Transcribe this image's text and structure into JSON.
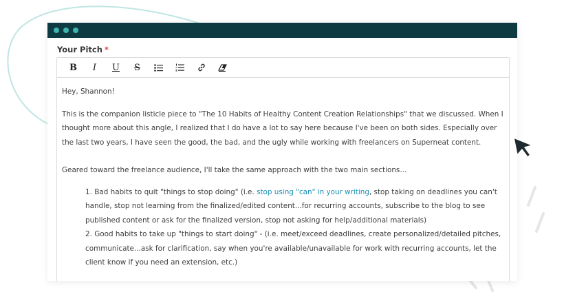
{
  "colors": {
    "titlebar": "#0d3b41",
    "dot": "#3fb5b0",
    "required": "#d64545",
    "link": "#1a8fb5",
    "decoration": "#bfe6e3"
  },
  "window": {
    "dots": [
      "dot",
      "dot",
      "dot"
    ]
  },
  "field": {
    "label": "Your Pitch",
    "required_marker": "*"
  },
  "toolbar": {
    "bold": "B",
    "italic": "I",
    "underline": "U",
    "strike": "S",
    "icons": [
      "bulleted-list-icon",
      "numbered-list-icon",
      "link-icon",
      "clear-format-icon"
    ]
  },
  "content": {
    "greeting": "Hey, Shannon!",
    "para1": "This is the companion listicle piece to \"The 10 Habits of Healthy Content Creation Relationships\" that we discussed. When I thought more about this angle, I realized that I do have a lot to say here because I've been on both sides. Especially over the last two years, I have seen the good, the bad, and the ugly while working with freelancers on Superneat content.",
    "para2": "Geared toward the freelance audience, I'll take the same approach with the two main sections...",
    "item1_prefix": "1. Bad habits to quit \"things to stop doing\" (i.e. ",
    "item1_link": "stop using \"can\" in your writing",
    "item1_suffix": ", stop taking on deadlines you can't handle, stop not learning from the finalized/edited content...for recurring accounts, subscribe to the blog to see published content or ask for the finalized version, stop not asking for help/additional materials)",
    "item2": "2. Good habits to take up \"things to start doing\" - (i.e. meet/exceed deadlines, create personalized/detailed pitches, communicate...ask for clarification, say when you're available/unavailable for work with recurring accounts, let the client know if you need an extension, etc.)"
  }
}
